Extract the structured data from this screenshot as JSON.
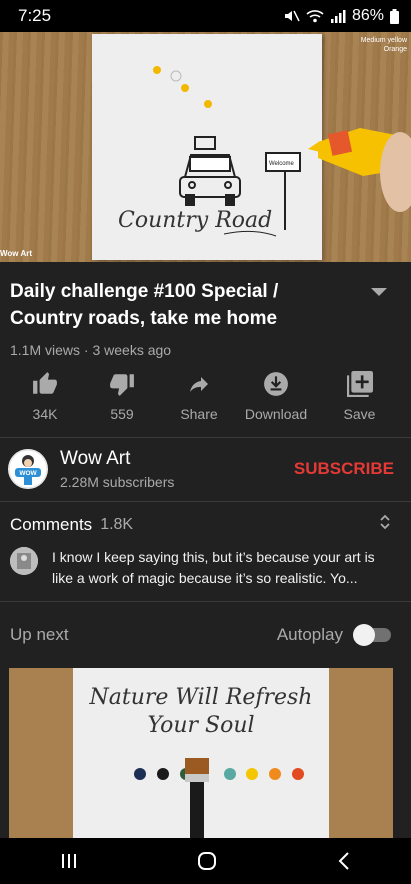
{
  "status_bar": {
    "time": "7:25",
    "battery": "86%"
  },
  "player": {
    "overlay_line1": "Medium yellow",
    "overlay_line2": "Orange",
    "watermark": "Wow Art",
    "painting_title": "Country Road",
    "sign_text": "Welcome"
  },
  "video": {
    "title": "Daily challenge #100 Special / Country roads, take me home",
    "meta": "1.1M views · 3 weeks ago"
  },
  "actions": [
    {
      "label": "34K",
      "icon": "thumbs-up-icon"
    },
    {
      "label": "559",
      "icon": "thumbs-down-icon"
    },
    {
      "label": "Share",
      "icon": "share-icon"
    },
    {
      "label": "Download",
      "icon": "download-icon"
    },
    {
      "label": "Save",
      "icon": "add-to-playlist-icon"
    }
  ],
  "channel": {
    "name": "Wow Art",
    "subscribers": "2.28M subscribers",
    "subscribe_label": "SUBSCRIBE",
    "avatar_text": "WOW"
  },
  "comments": {
    "label": "Comments",
    "count": "1.8K",
    "preview": "I know I keep saying this, but it’s because your art is like a work of magic because it’s so realistic. Yo..."
  },
  "up_next": {
    "label": "Up next",
    "autoplay_label": "Autoplay",
    "autoplay_on": false,
    "next_video_title_line1": "Nature Will Refresh",
    "next_video_title_line2": "Your Soul"
  },
  "colors": {
    "accent_red": "#e53935",
    "background": "#212121"
  }
}
